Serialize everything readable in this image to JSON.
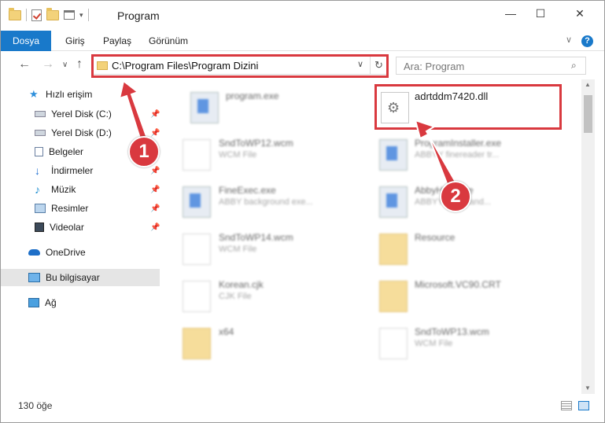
{
  "window": {
    "title": "Program",
    "controls": [
      "—",
      "☐",
      "✕"
    ]
  },
  "ribbon": {
    "tabs": [
      "Dosya",
      "Giriş",
      "Paylaş",
      "Görünüm"
    ]
  },
  "address": {
    "path": "C:\\Program Files\\Program Dizini",
    "search_placeholder": "Ara: Program"
  },
  "sidebar": {
    "items": [
      {
        "label": "Hızlı erişim",
        "icon": "star-icon"
      },
      {
        "label": "Yerel Disk (C:)",
        "icon": "drive-icon"
      },
      {
        "label": "Yerel Disk (D:)",
        "icon": "drive-icon"
      },
      {
        "label": "Belgeler",
        "icon": "documents-icon"
      },
      {
        "label": "İndirmeler",
        "icon": "download-icon"
      },
      {
        "label": "Müzik",
        "icon": "music-icon"
      },
      {
        "label": "Resimler",
        "icon": "pictures-icon"
      },
      {
        "label": "Videolar",
        "icon": "videos-icon"
      },
      {
        "label": "OneDrive",
        "icon": "cloud-icon"
      },
      {
        "label": "Bu bilgisayar",
        "icon": "computer-icon"
      },
      {
        "label": "Ağ",
        "icon": "network-icon"
      }
    ]
  },
  "files": [
    {
      "name": "program.exe",
      "sub": ""
    },
    {
      "name": "adrtddm7420.dll",
      "sub": ""
    },
    {
      "name": "SndToWP12.wcm",
      "sub": "WCM File"
    },
    {
      "name": "ProgramInstaller.exe",
      "sub": "ABBYY finereader tr..."
    },
    {
      "name": "FineExec.exe",
      "sub": "ABBY background exe..."
    },
    {
      "name": "AbbyHost.exe",
      "sub": "ABBYY host hand..."
    },
    {
      "name": "SndToWP14.wcm",
      "sub": "WCM File"
    },
    {
      "name": "Resource",
      "sub": ""
    },
    {
      "name": "Korean.cjk",
      "sub": "CJK File"
    },
    {
      "name": "Microsoft.VC90.CRT",
      "sub": ""
    },
    {
      "name": "x64",
      "sub": ""
    },
    {
      "name": "SndToWP13.wcm",
      "sub": "WCM File"
    }
  ],
  "status": {
    "count": "130 öğe"
  },
  "annotations": [
    "1",
    "2"
  ],
  "colors": {
    "accent": "#1979ca",
    "highlight": "#d9393f"
  }
}
